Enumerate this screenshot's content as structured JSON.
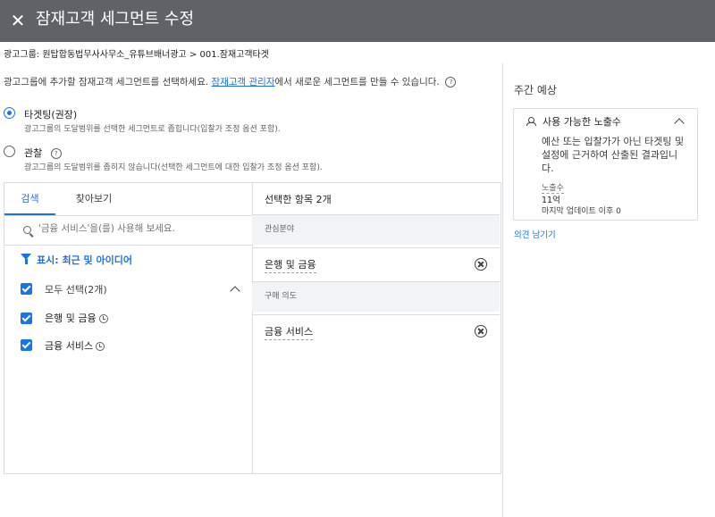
{
  "header": {
    "close_icon": "close-icon",
    "title": "잠재고객 세그먼트 수정",
    "bg_color": "#5f6368"
  },
  "breadcrumb": "광고그룹: 원탑합동법무사사무소_유튜브배너광고 > 001.잠재고객타겟",
  "intro": {
    "text_before": "광고그룹에 추가할 잠재고객 세그먼트를 선택하세요. ",
    "link": "잠재고객 관리자",
    "text_after": "에서 새로운 세그먼트를 만들 수 있습니다."
  },
  "options": [
    {
      "label": "타겟팅(권장)",
      "desc": "광고그룹의 도달범위를 선택한 세그먼트로 좁힙니다(입찰가 조정 옵션 포함).",
      "selected": true
    },
    {
      "label": "관찰",
      "desc": "광고그룹의 도달범위를 좁히지 않습니다(선택한 세그먼트에 대한 입찰가 조정 옵션 포함).",
      "selected": false
    }
  ],
  "browse": {
    "tabs": [
      "검색",
      "찾아보기"
    ],
    "active_tab": 0,
    "search_placeholder": "'금융 서비스'을(를) 사용해 보세요.",
    "filter_label": "표시: 최근 및 아이디어",
    "select_all": "모두 선택(2개)",
    "items": [
      "은행 및 금융",
      "금융 서비스"
    ]
  },
  "selected": {
    "title": "선택한 항목 2개",
    "groups": [
      {
        "name": "관심분야",
        "items": [
          "은행 및 금융"
        ]
      },
      {
        "name": "구매 의도",
        "items": [
          "금융 서비스"
        ]
      }
    ]
  },
  "side": {
    "title": "주간 예상",
    "card_title": "사용 가능한 노출수",
    "card_desc": "예산 또는 입찰가가 아닌 타겟팅 및 설정에 근거하여 산출된 결과입니다.",
    "metric_label": "노출수",
    "metric_value": "11억",
    "updated": "마지막 업데이트 이후 0",
    "feedback": "의견 남기기"
  },
  "colors": {
    "accent": "#1a73e8",
    "border": "#dadce0",
    "group_bg": "#f1f3f4"
  }
}
